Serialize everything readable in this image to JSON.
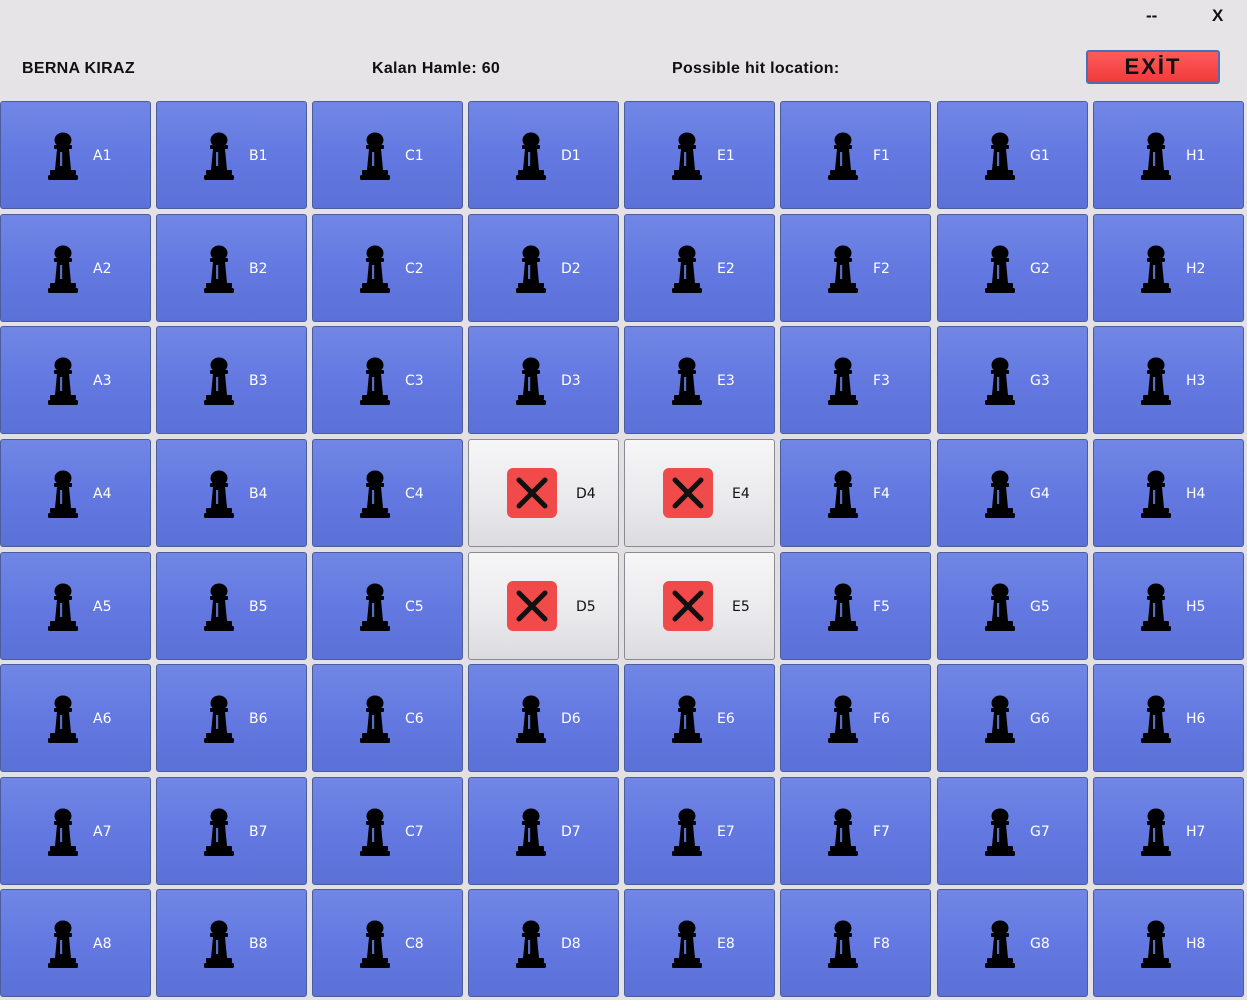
{
  "window": {
    "minimize_label": "--",
    "close_label": "X"
  },
  "header": {
    "player_name": "BERNA KIRAZ",
    "moves_left": "Kalan Hamle: 60",
    "hit_location_label": "Possible hit location:",
    "exit_label": "EXİT"
  },
  "colors": {
    "cell_blue": "#6379e1",
    "hit_cell": "#ececef",
    "x_red": "#f04a4a",
    "exit_red": "#f03a3a"
  },
  "board": {
    "columns": [
      "A",
      "B",
      "C",
      "D",
      "E",
      "F",
      "G",
      "H"
    ],
    "rows": [
      1,
      2,
      3,
      4,
      5,
      6,
      7,
      8
    ],
    "piece_icon": "pawn-icon",
    "hit_icon": "x-mark-icon",
    "hit_cells": [
      "D4",
      "E4",
      "D5",
      "E5"
    ]
  }
}
